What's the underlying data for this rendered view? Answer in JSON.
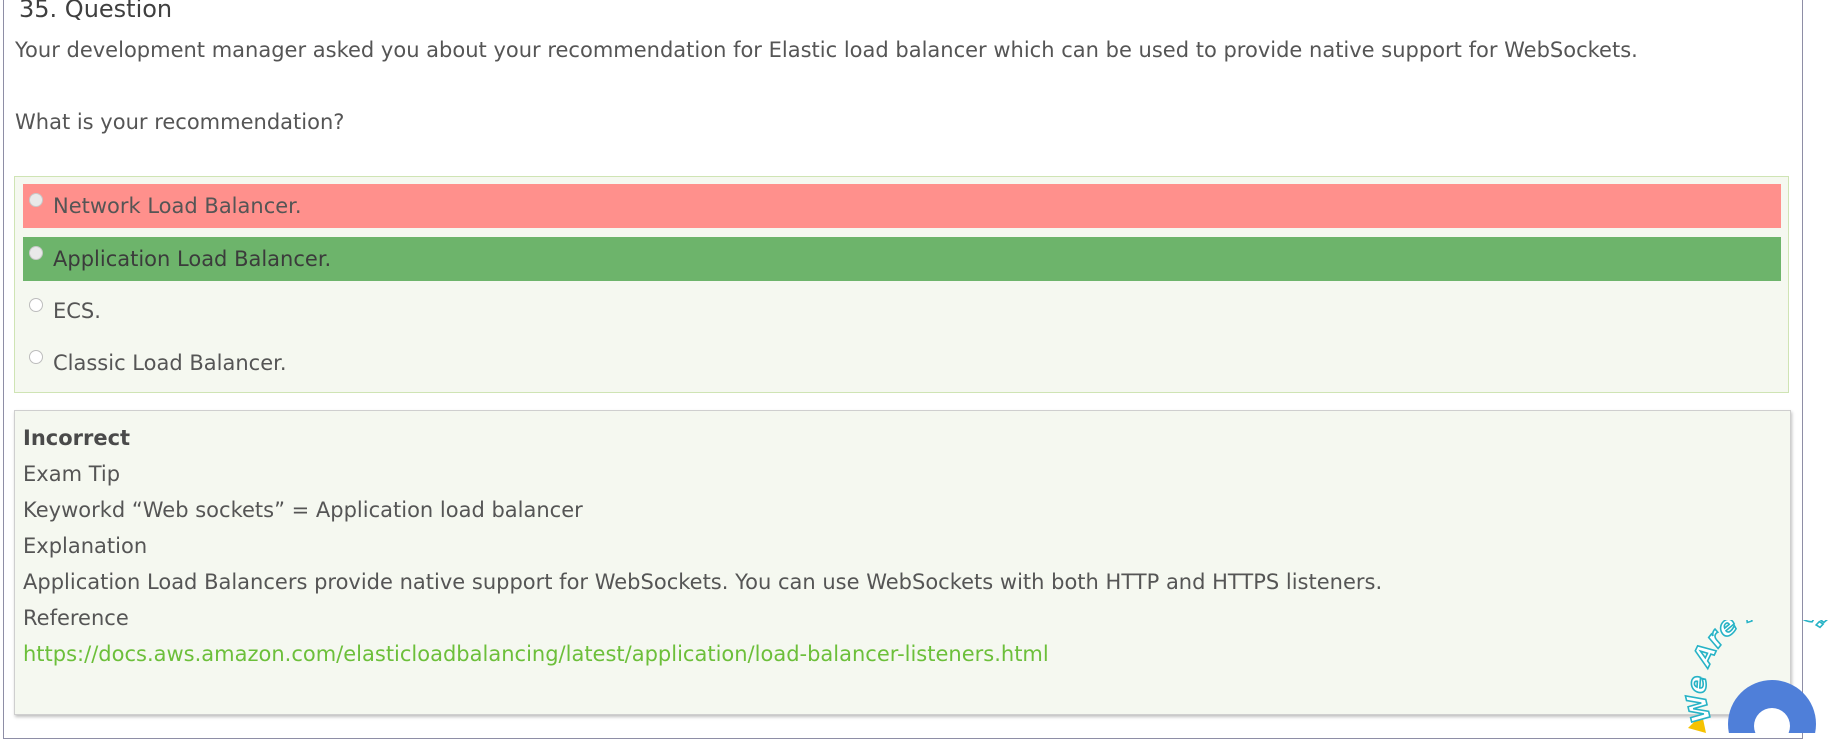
{
  "question": {
    "title": "35. Question",
    "text": "Your development manager asked you about your recommendation for Elastic load balancer which can be used to provide native support for WebSockets.",
    "prompt": "What is your recommendation?"
  },
  "options": [
    {
      "label": "Network Load Balancer.",
      "state": "selected-incorrect"
    },
    {
      "label": "Application Load Balancer.",
      "state": "correct"
    },
    {
      "label": "ECS.",
      "state": "none"
    },
    {
      "label": "Classic Load Balancer.",
      "state": "none"
    }
  ],
  "feedback": {
    "status": "Incorrect",
    "tip_heading": "Exam Tip",
    "tip_text": "Keyworkd “Web sockets” = Application load balancer",
    "explanation_heading": "Explanation",
    "explanation_text": "Application Load Balancers provide native support for WebSockets. You can use WebSockets with both HTTP and HTTPS listeners.",
    "reference_heading": "Reference",
    "reference_link": "https://docs.aws.amazon.com/elasticloadbalancing/latest/application/load-balancer-listeners.html"
  },
  "chat_widget": {
    "text": "We Are Here!",
    "icon": "chat-bubble-icon"
  },
  "colors": {
    "incorrect_bg": "#ff908c",
    "correct_bg": "#6db46b",
    "panel_bg": "#f5f8f0",
    "link": "#6cbf3a",
    "chat_blue": "#4f7fd9",
    "chat_text": "#27b3c6"
  }
}
